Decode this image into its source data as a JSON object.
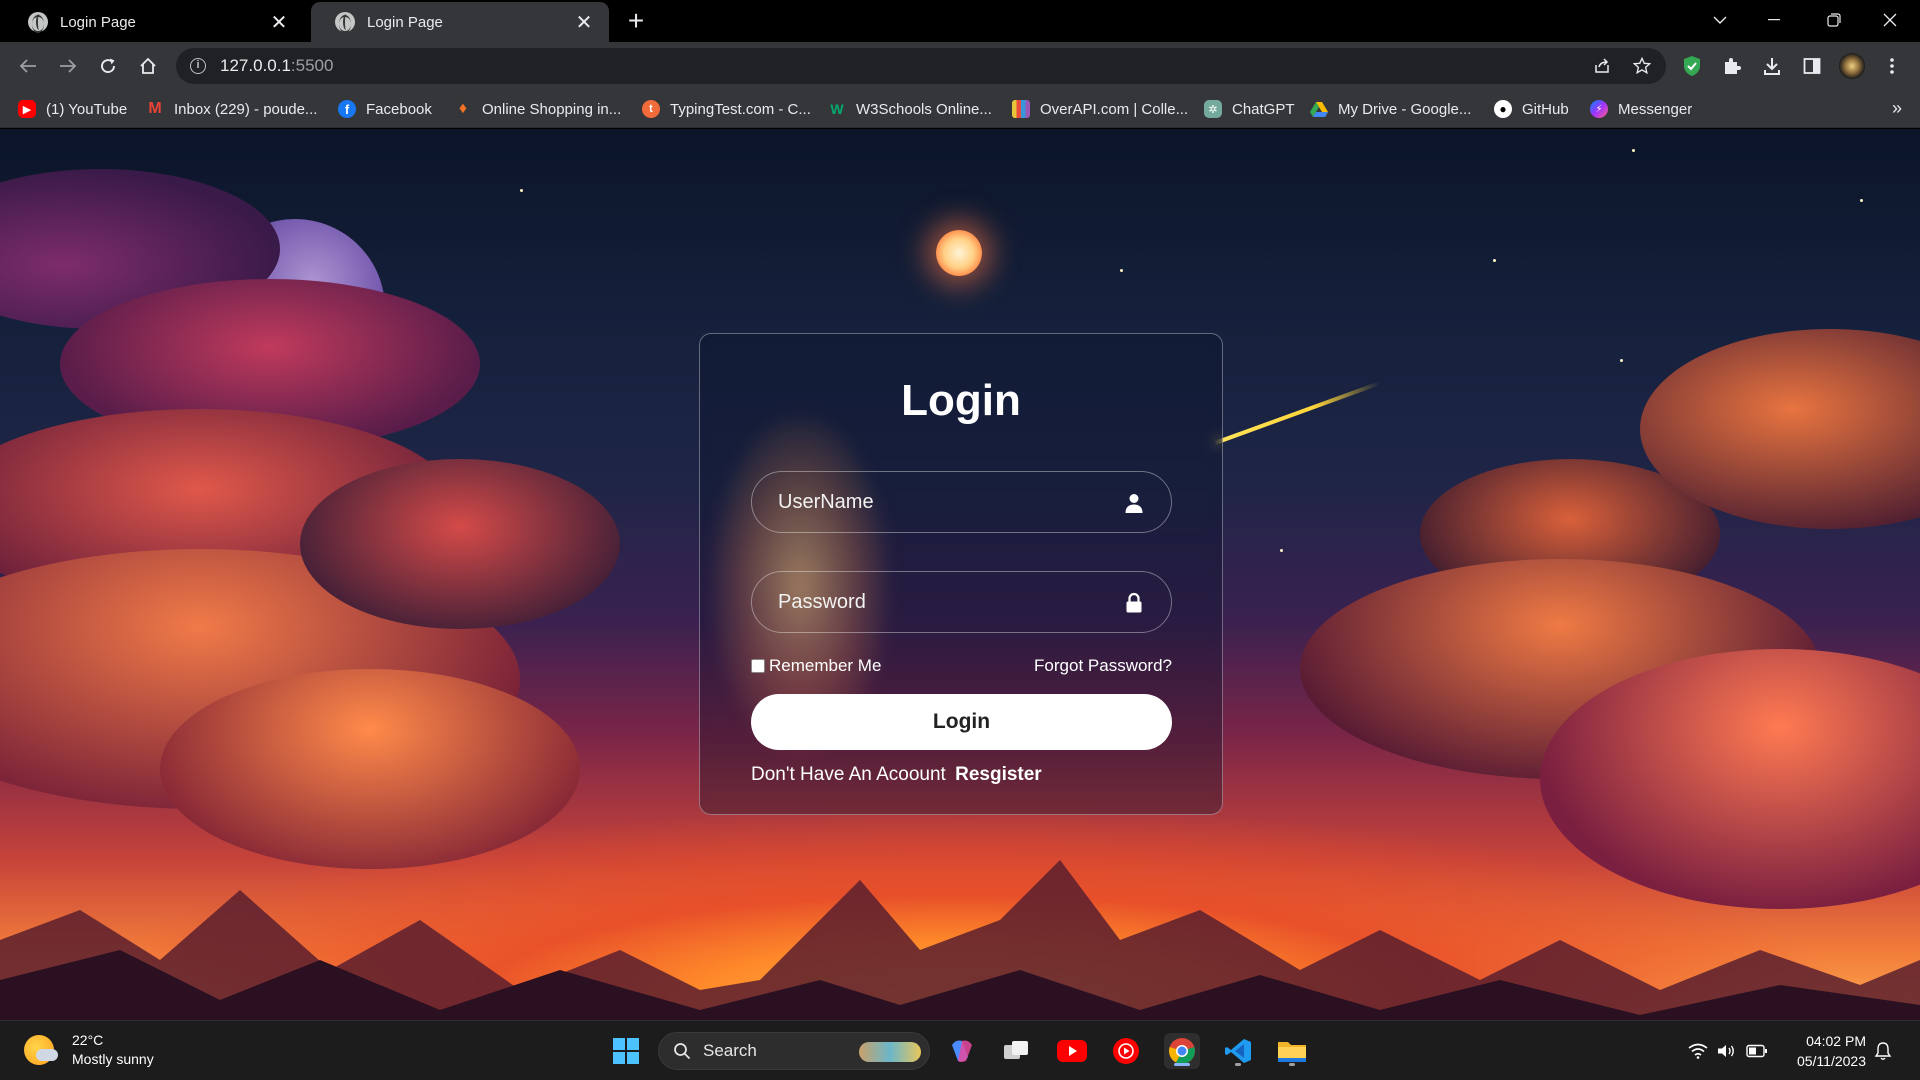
{
  "browser": {
    "tabs": [
      {
        "title": "Login Page",
        "active": false
      },
      {
        "title": "Login Page",
        "active": true
      }
    ],
    "url_host": "127.0.0.1",
    "url_port": ":5500",
    "bookmarks": [
      {
        "label": "(1) YouTube",
        "icon": "youtube-icon",
        "color": "#ff0000"
      },
      {
        "label": "Inbox (229) - poude...",
        "icon": "gmail-icon",
        "color": "#ea4335"
      },
      {
        "label": "Facebook",
        "icon": "facebook-icon",
        "color": "#1877f2"
      },
      {
        "label": "Online Shopping in...",
        "icon": "daraz-icon",
        "color": "#f57224"
      },
      {
        "label": "TypingTest.com - C...",
        "icon": "typingtest-icon",
        "color": "#f26b3a"
      },
      {
        "label": "W3Schools Online...",
        "icon": "w3schools-icon",
        "color": "#04aa6d"
      },
      {
        "label": "OverAPI.com | Colle...",
        "icon": "overapi-icon",
        "color": "#e8c43a"
      },
      {
        "label": "ChatGPT",
        "icon": "chatgpt-icon",
        "color": "#74aa9c"
      },
      {
        "label": "My Drive - Google...",
        "icon": "google-drive-icon",
        "color": "#fbbc04"
      },
      {
        "label": "GitHub",
        "icon": "github-icon",
        "color": "#ffffff"
      },
      {
        "label": "Messenger",
        "icon": "messenger-icon",
        "color": "#a033ff"
      }
    ]
  },
  "login": {
    "title": "Login",
    "username_placeholder": "UserName",
    "password_placeholder": "Password",
    "remember_label": "Remember Me",
    "forgot_label": "Forgot Password?",
    "button_label": "Login",
    "register_prompt": "Don't Have An Acoount",
    "register_link": "Resgister"
  },
  "taskbar": {
    "weather_temp": "22°C",
    "weather_desc": "Mostly sunny",
    "search_label": "Search",
    "time": "04:02 PM",
    "date": "05/11/2023"
  },
  "colors": {
    "tab_active": "#35363a",
    "toolbar": "#35363a",
    "taskbar": "#1c1c1c",
    "accent": "#8ab4f8"
  }
}
